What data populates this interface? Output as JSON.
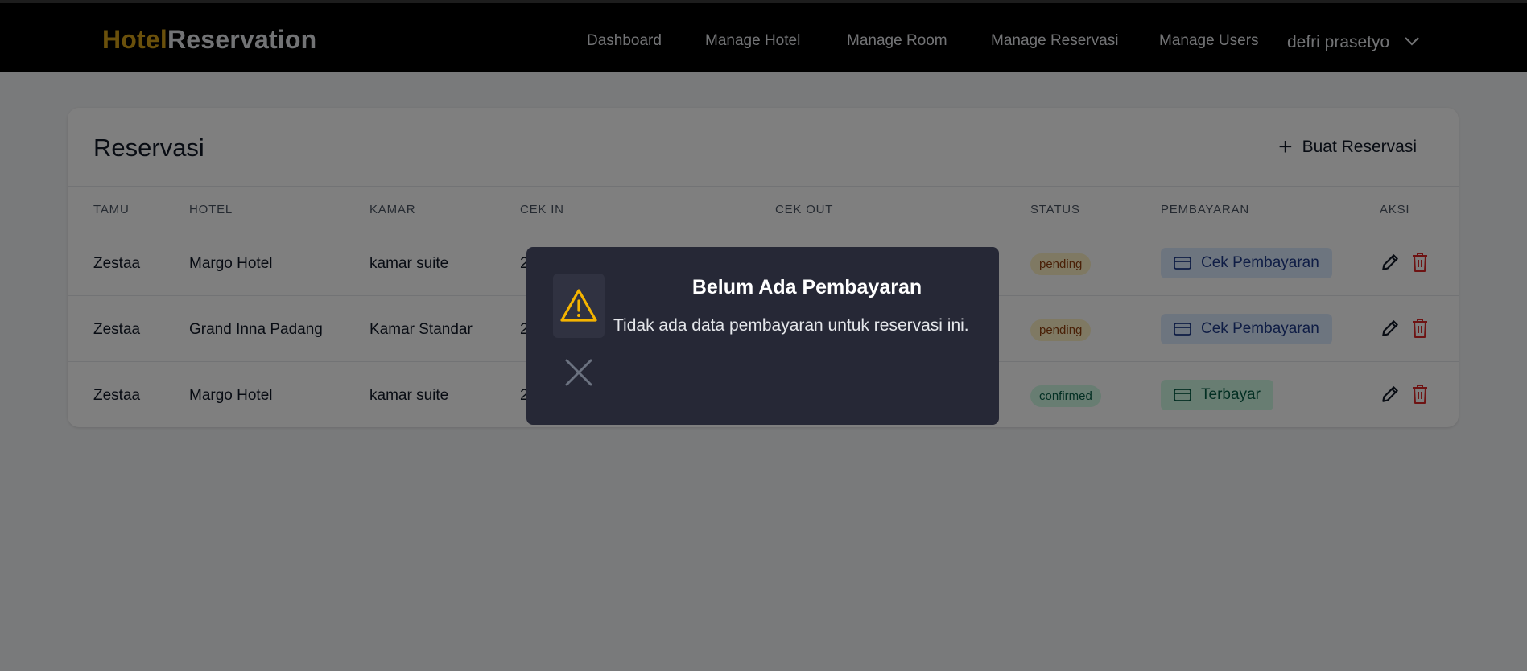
{
  "header": {
    "logo_part1": "Hotel",
    "logo_part2": "Reservation",
    "nav": [
      "Dashboard",
      "Manage Hotel",
      "Manage Room",
      "Manage Reservasi",
      "Manage Users"
    ],
    "user_name": "defri prasetyo"
  },
  "page": {
    "title": "Reservasi",
    "new_button": "Buat Reservasi"
  },
  "table": {
    "columns": [
      "TAMU",
      "HOTEL",
      "KAMAR",
      "CEK IN",
      "CEK OUT",
      "STATUS",
      "PEMBAYARAN",
      "AKSI"
    ],
    "rows": [
      {
        "guest": "Zestaa",
        "hotel": "Margo Hotel",
        "room": "kamar suite",
        "checkin": "2",
        "status": "pending",
        "payment": "Cek Pembayaran"
      },
      {
        "guest": "Zestaa",
        "hotel": "Grand Inna Padang",
        "room": "Kamar Standar",
        "checkin": "2",
        "status": "pending",
        "payment": "Cek Pembayaran"
      },
      {
        "guest": "Zestaa",
        "hotel": "Margo Hotel",
        "room": "kamar suite",
        "checkin": "2",
        "status": "confirmed",
        "payment": "Terbayar"
      }
    ]
  },
  "modal": {
    "title": "Belum Ada Pembayaran",
    "message": "Tidak ada data pembayaran untuk reservasi ini."
  },
  "colors": {
    "brand_gold": "#d4a017",
    "overlay": "rgba(0,0,0,0.5)",
    "modal_bg": "#262836",
    "warning": "#f5b400",
    "danger": "#dc2626"
  },
  "icons": {
    "chevron": "chevron-down-icon",
    "plus": "plus-icon",
    "card": "credit-card-icon",
    "edit": "pencil-icon",
    "delete": "trash-icon",
    "warning": "warning-icon",
    "close": "close-icon"
  }
}
